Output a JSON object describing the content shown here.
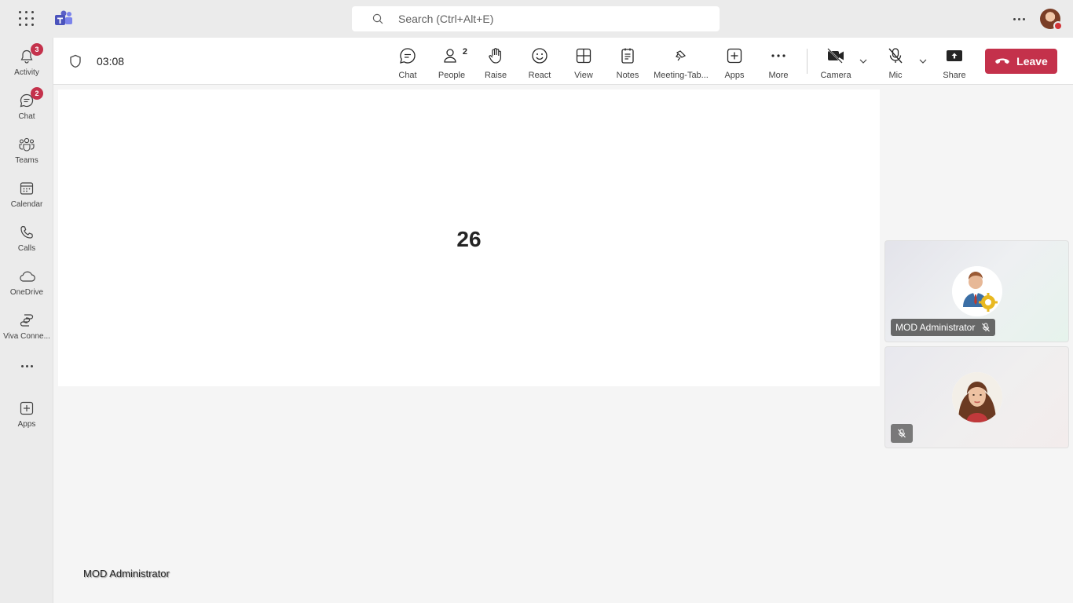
{
  "search": {
    "placeholder": "Search (Ctrl+Alt+E)"
  },
  "rail": {
    "items": [
      {
        "label": "Activity",
        "badge": "3"
      },
      {
        "label": "Chat",
        "badge": "2"
      },
      {
        "label": "Teams"
      },
      {
        "label": "Calendar"
      },
      {
        "label": "Calls"
      },
      {
        "label": "OneDrive"
      },
      {
        "label": "Viva Conne..."
      },
      {
        "label": "Apps"
      }
    ]
  },
  "meeting": {
    "timer": "03:08",
    "tools": {
      "chat": "Chat",
      "people": "People",
      "people_count": "2",
      "raise": "Raise",
      "react": "React",
      "view": "View",
      "notes": "Notes",
      "meeting_tab": "Meeting-Tab...",
      "apps": "Apps",
      "more": "More",
      "camera": "Camera",
      "mic": "Mic",
      "share": "Share"
    },
    "leave_label": "Leave"
  },
  "stage": {
    "number": "26"
  },
  "participants": [
    {
      "name": "MOD Administrator",
      "muted": true
    },
    {
      "name": "",
      "muted": true
    }
  ],
  "bottom_name": "MOD Administrator",
  "colors": {
    "leave": "#c4314b",
    "badge": "#c4314b",
    "brand": "#5b5fc7"
  }
}
